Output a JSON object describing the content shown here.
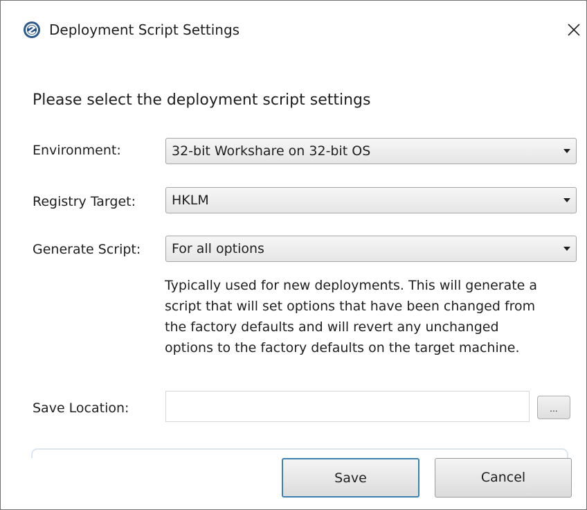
{
  "window": {
    "title": "Deployment Script Settings",
    "icon": "app-logo-icon",
    "close_icon": "close-icon",
    "close_glyph": "✕"
  },
  "heading": "Please select the deployment script settings",
  "fields": {
    "environment": {
      "label": "Environment:",
      "value": "32-bit Workshare on 32-bit OS"
    },
    "registry_target": {
      "label": "Registry Target:",
      "value": "HKLM"
    },
    "generate_script": {
      "label": "Generate Script:",
      "value": "For all options"
    },
    "save_location": {
      "label": "Save Location:",
      "value": "",
      "browse_label": "..."
    }
  },
  "description_lines": [
    "Typically used for new deployments. This will generate a",
    "script that will set options that have been changed from",
    "the factory defaults and will revert any unchanged",
    "options to the factory defaults on the target machine."
  ],
  "buttons": {
    "save": "Save",
    "cancel": "Cancel"
  },
  "colors": {
    "default_button_border": "#3c7fb1",
    "divider": "#d9e6f2"
  }
}
